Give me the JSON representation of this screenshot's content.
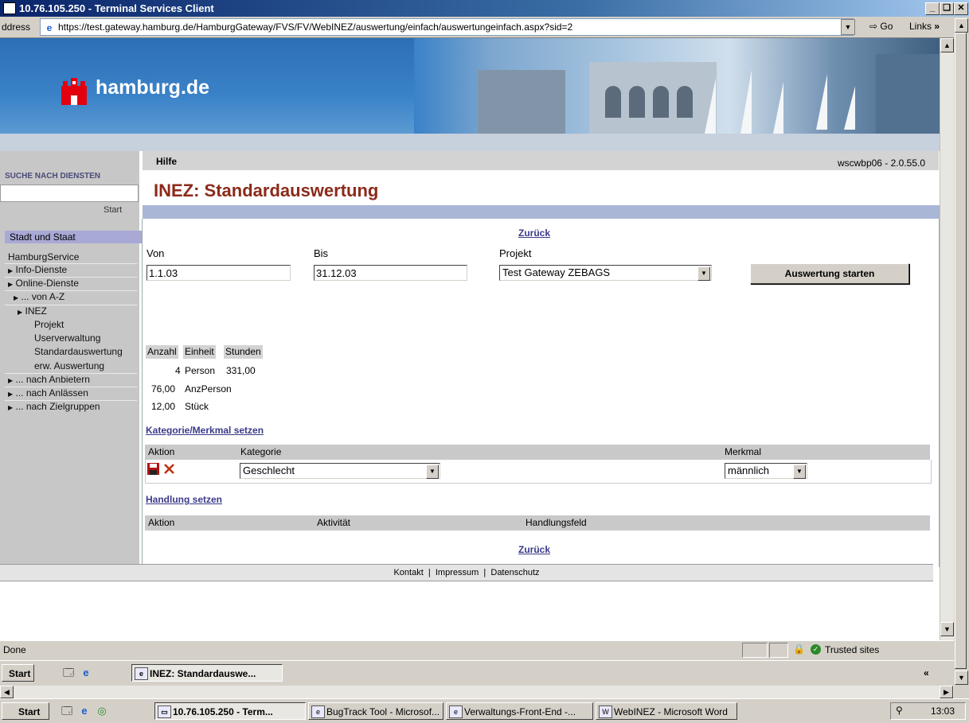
{
  "window": {
    "title": "10.76.105.250 - Terminal Services Client"
  },
  "addressbar": {
    "label": "ddress",
    "url": "https://test.gateway.hamburg.de/HamburgGateway/FVS/FV/WebINEZ/auswertung/einfach/auswertungeinfach.aspx?sid=2",
    "go": "Go",
    "links": "Links"
  },
  "banner": {
    "site": "hamburg.de"
  },
  "search": {
    "heading": "SUCHE NACH DIENSTEN",
    "start": "Start"
  },
  "nav": {
    "heading": "Stadt und Staat",
    "items": [
      {
        "label": "HamburgService"
      },
      {
        "label": "Info-Dienste"
      },
      {
        "label": "Online-Dienste"
      },
      {
        "label": "... von A-Z"
      },
      {
        "label": "INEZ"
      },
      {
        "label": "Projekt"
      },
      {
        "label": "Userverwaltung"
      },
      {
        "label": "Standardauswertung"
      },
      {
        "label": "erw. Auswertung"
      },
      {
        "label": "... nach Anbietern"
      },
      {
        "label": "... nach Anlässen"
      },
      {
        "label": "... nach Zielgruppen"
      }
    ]
  },
  "main": {
    "help": "Hilfe",
    "version": "wscwbp06 - 2.0.55.0",
    "title": "INEZ: Standardauswertung",
    "back_top": "Zurück",
    "back_bottom": "Zurück",
    "filter": {
      "from_label": "Von",
      "from_value": "1.1.03",
      "to_label": "Bis",
      "to_value": "31.12.03",
      "project_label": "Projekt",
      "project_value": "Test Gateway ZEBAGS",
      "start_button": "Auswertung starten"
    },
    "results": {
      "headers": [
        "Anzahl",
        "Einheit",
        "Stunden"
      ],
      "rows": [
        {
          "anzahl": "4",
          "einheit": "Person",
          "stunden": "331,00"
        },
        {
          "anzahl": "76,00",
          "einheit": "AnzPerson",
          "stunden": ""
        },
        {
          "anzahl": "12,00",
          "einheit": "Stück",
          "stunden": ""
        }
      ]
    },
    "category_link": "Kategorie/Merkmal setzen",
    "category_table": {
      "col_action": "Aktion",
      "col_category": "Kategorie",
      "col_feature": "Merkmal",
      "category_value": "Geschlecht",
      "feature_value": "männlich"
    },
    "action_link": "Handlung setzen",
    "action_table": {
      "col_action": "Aktion",
      "col_activity": "Aktivität",
      "col_field": "Handlungsfeld"
    },
    "footer": {
      "contact": "Kontakt",
      "imprint": "Impressum",
      "privacy": "Datenschutz"
    }
  },
  "status": {
    "text": "Done",
    "zone": "Trusted sites"
  },
  "inner_taskbar": {
    "start": "Start",
    "task": "INEZ: Standardauswe..."
  },
  "outer_taskbar": {
    "start": "Start",
    "tasks": [
      {
        "label": "10.76.105.250 - Term..."
      },
      {
        "label": "BugTrack Tool - Microsof..."
      },
      {
        "label": "Verwaltungs-Front-End -..."
      },
      {
        "label": "WebINEZ - Microsoft Word"
      }
    ],
    "clock": "13:03"
  }
}
